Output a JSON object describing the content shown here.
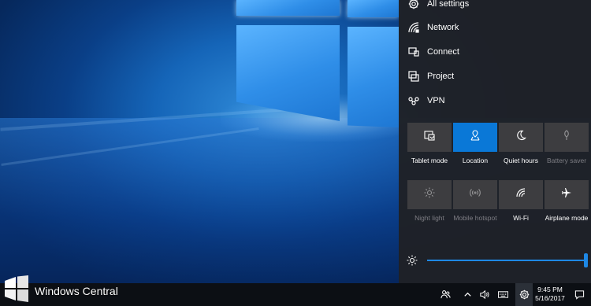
{
  "action_center": {
    "quick_links": [
      {
        "label": "All settings",
        "icon": "gear-icon"
      },
      {
        "label": "Network",
        "icon": "network-icon"
      },
      {
        "label": "Connect",
        "icon": "connect-icon"
      },
      {
        "label": "Project",
        "icon": "project-icon"
      },
      {
        "label": "VPN",
        "icon": "vpn-icon"
      }
    ],
    "tiles": [
      {
        "label": "Tablet mode",
        "icon": "tablet-mode-icon",
        "state": "off"
      },
      {
        "label": "Location",
        "icon": "location-icon",
        "state": "on"
      },
      {
        "label": "Quiet hours",
        "icon": "moon-icon",
        "state": "off"
      },
      {
        "label": "Battery saver",
        "icon": "leaf-icon",
        "state": "disabled"
      },
      {
        "label": "Night light",
        "icon": "sun-icon",
        "state": "disabled"
      },
      {
        "label": "Mobile hotspot",
        "icon": "hotspot-icon",
        "state": "disabled"
      },
      {
        "label": "Wi-Fi",
        "icon": "wifi-icon",
        "state": "off"
      },
      {
        "label": "Airplane mode",
        "icon": "airplane-icon",
        "state": "off"
      }
    ],
    "brightness": {
      "icon": "brightness-icon",
      "level": 1.0
    },
    "accent_color": "#0a78d7"
  },
  "taskbar": {
    "icons": [
      "people-icon",
      "chevron-up-icon",
      "volume-icon",
      "keyboard-icon",
      "gear-icon",
      "notification-icon"
    ],
    "time": "9:45 PM",
    "date": "5/16/2017"
  },
  "watermark": {
    "text": "Windows Central"
  }
}
